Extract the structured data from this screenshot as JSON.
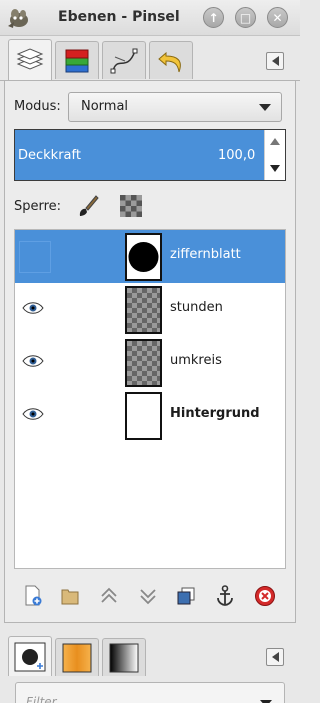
{
  "window": {
    "title": "Ebenen - Pinsel",
    "app_icon": "gimp-wilber-icon",
    "buttons": {
      "up_glyph": "↑",
      "maximize_glyph": "□",
      "close_glyph": "✕"
    }
  },
  "dock_tabs": [
    {
      "name": "layers-tab",
      "icon": "layers-icon",
      "active": true
    },
    {
      "name": "channels-tab",
      "icon": "channels-icon",
      "active": false
    },
    {
      "name": "paths-tab",
      "icon": "paths-icon",
      "active": false
    },
    {
      "name": "undo-history-tab",
      "icon": "undo-icon",
      "active": false
    }
  ],
  "mode": {
    "label": "Modus:",
    "value": "Normal"
  },
  "opacity": {
    "label": "Deckkraft",
    "value": "100,0",
    "fraction": 0.922
  },
  "lock": {
    "label": "Sperre:",
    "icons": [
      "brush-lock-icon",
      "alpha-lock-icon"
    ]
  },
  "layers": [
    {
      "name": "ziffernblatt",
      "visible": false,
      "selected": true,
      "thumb": "black-circle",
      "bold": false
    },
    {
      "name": "stunden",
      "visible": true,
      "selected": false,
      "thumb": "transparent",
      "bold": false
    },
    {
      "name": "umkreis",
      "visible": true,
      "selected": false,
      "thumb": "transparent",
      "bold": false
    },
    {
      "name": "Hintergrund",
      "visible": true,
      "selected": false,
      "thumb": "white",
      "bold": true
    }
  ],
  "layer_toolbar": [
    "new-layer-icon",
    "new-layer-group-icon",
    "raise-layer-icon",
    "lower-layer-icon",
    "duplicate-layer-icon",
    "anchor-layer-icon",
    "delete-layer-icon"
  ],
  "bottom_tabs": [
    {
      "name": "brushes-tab",
      "icon": "brush-icon",
      "active": true
    },
    {
      "name": "patterns-tab",
      "icon": "pattern-icon",
      "active": false
    },
    {
      "name": "gradients-tab",
      "icon": "gradient-icon",
      "active": false
    }
  ],
  "filter": {
    "placeholder": "Filter"
  },
  "colors": {
    "accent": "#4a90d9",
    "background": "#e8e8e8"
  }
}
